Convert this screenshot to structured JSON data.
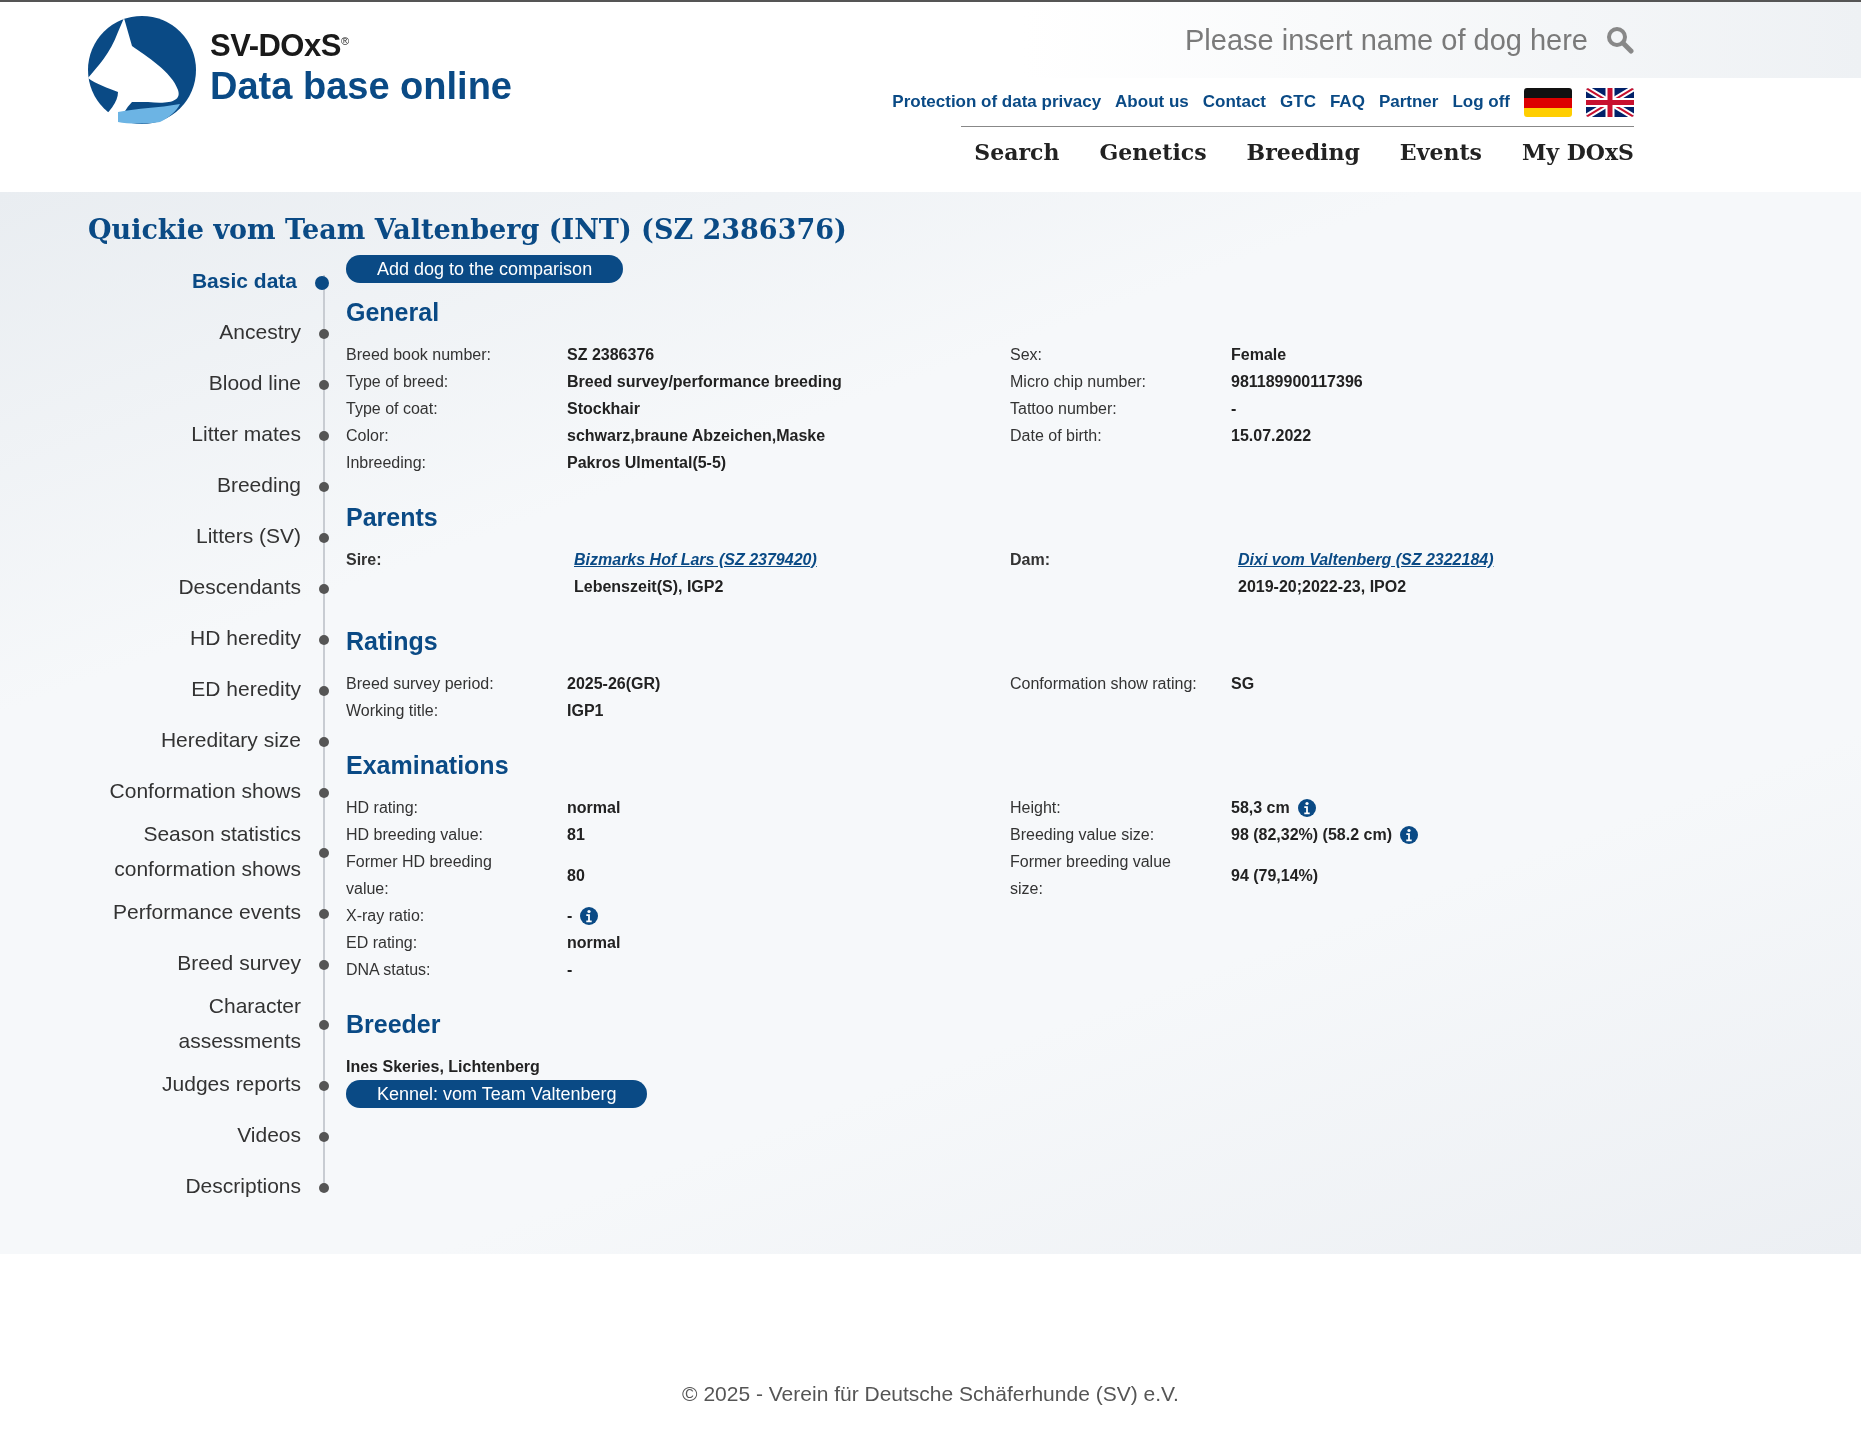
{
  "header": {
    "logo": {
      "brand": "SV-DOxS",
      "mark": "®",
      "subtitle": "Data base online"
    },
    "search": {
      "placeholder": "Please insert name of dog here"
    },
    "top_links": [
      "Protection of data privacy",
      "About us",
      "Contact",
      "GTC",
      "FAQ",
      "Partner",
      "Log off"
    ],
    "languages": [
      {
        "kind": "german"
      },
      {
        "kind": "british"
      }
    ],
    "main_nav": [
      "Search",
      "Genetics",
      "Breeding",
      "Events",
      "My DOxS"
    ]
  },
  "title": "Quickie vom Team Valtenberg (INT) (SZ 2386376)",
  "side_nav": [
    {
      "label": "Basic data",
      "selected": true
    },
    {
      "label": "Ancestry",
      "selected": false
    },
    {
      "label": "Blood line",
      "selected": false
    },
    {
      "label": "Litter mates",
      "selected": false
    },
    {
      "label": "Breeding",
      "selected": false
    },
    {
      "label": "Litters (SV)",
      "selected": false
    },
    {
      "label": "Descendants",
      "selected": false
    },
    {
      "label": "HD heredity",
      "selected": false
    },
    {
      "label": "ED heredity",
      "selected": false
    },
    {
      "label": "Hereditary size",
      "selected": false
    },
    {
      "label": "Conformation shows",
      "selected": false
    },
    {
      "label": "Season statistics conformation shows",
      "selected": false
    },
    {
      "label": "Performance events",
      "selected": false
    },
    {
      "label": "Breed survey",
      "selected": false
    },
    {
      "label": "Character assessments",
      "selected": false
    },
    {
      "label": "Judges reports",
      "selected": false
    },
    {
      "label": "Videos",
      "selected": false
    },
    {
      "label": "Descriptions",
      "selected": false
    }
  ],
  "compare_button": "Add dog to the comparison",
  "sections": [
    {
      "kind": "fields",
      "title": "General",
      "left": [
        {
          "label": "Breed book number:",
          "value": "SZ 2386376",
          "info": false
        },
        {
          "label": "Type of breed:",
          "value": "Breed survey/performance breeding",
          "info": false
        },
        {
          "label": "Type of coat:",
          "value": "Stockhair",
          "info": false
        },
        {
          "label": "Color:",
          "value": "schwarz,braune Abzeichen,Maske",
          "info": false
        },
        {
          "label": "Inbreeding:",
          "value": "Pakros Ulmental(5-5)",
          "info": false
        }
      ],
      "right": [
        {
          "label": "Sex:",
          "value": "Female",
          "info": false
        },
        {
          "label": "Micro chip number:",
          "value": "981189900117396",
          "info": false
        },
        {
          "label": "Tattoo number:",
          "value": "-",
          "info": false
        },
        {
          "label": "Date of birth:",
          "value": "15.07.2022",
          "info": false
        }
      ]
    },
    {
      "kind": "parents",
      "title": "Parents",
      "parents": [
        {
          "label": "Sire:",
          "link": "Bizmarks Hof Lars (SZ 2379420)",
          "detail": "Lebenszeit(S), IGP2"
        },
        {
          "label": "Dam:",
          "link": "Dixi vom Valtenberg (SZ 2322184)",
          "detail": "2019-20;2022-23, IPO2"
        }
      ]
    },
    {
      "kind": "fields",
      "title": "Ratings",
      "left": [
        {
          "label": "Breed survey period:",
          "value": "2025-26(GR)",
          "info": false
        },
        {
          "label": "Working title:",
          "value": "IGP1",
          "info": false
        }
      ],
      "right": [
        {
          "label": "Conformation show rating:",
          "value": "SG",
          "info": false
        }
      ]
    },
    {
      "kind": "fields",
      "title": "Examinations",
      "left": [
        {
          "label": "HD rating:",
          "value": "normal",
          "info": false
        },
        {
          "label": "HD breeding value:",
          "value": "81",
          "info": false
        },
        {
          "label": "Former HD breeding value:",
          "value": "80",
          "info": false
        },
        {
          "label": "X-ray ratio:",
          "value": "-",
          "info": true
        },
        {
          "label": "ED rating:",
          "value": "normal",
          "info": false
        },
        {
          "label": "DNA status:",
          "value": "-",
          "info": false
        }
      ],
      "right": [
        {
          "label": "Height:",
          "value": "58,3 cm",
          "info": true
        },
        {
          "label": "Breeding value size:",
          "value": "98 (82,32%) (58.2 cm)",
          "info": true
        },
        {
          "label": "Former breeding value size:",
          "value": "94 (79,14%)",
          "info": false
        }
      ]
    },
    {
      "kind": "breeder",
      "title": "Breeder",
      "name": "Ines Skeries, Lichtenberg",
      "button": "Kennel: vom Team Valtenberg"
    }
  ],
  "footer": "© 2025 - Verein für Deutsche Schäferhunde (SV) e.V."
}
